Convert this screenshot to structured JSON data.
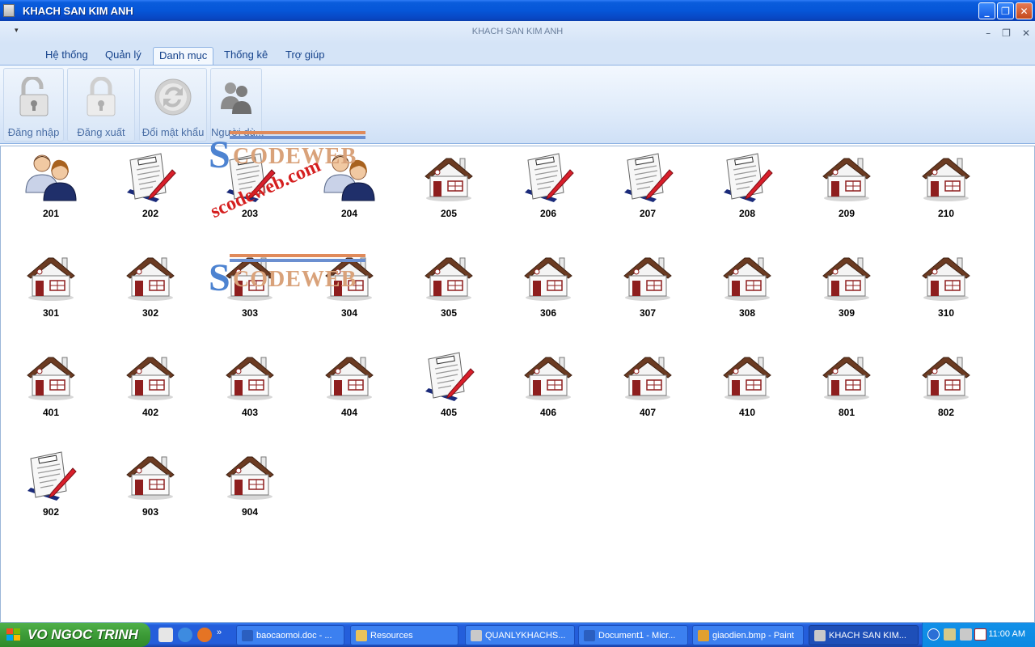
{
  "window": {
    "title": "KHACH SAN KIM ANH",
    "mdi_title": "KHACH SAN KIM ANH"
  },
  "menu_tabs": [
    "Hệ thống",
    "Quản lý",
    "Danh mục",
    "Thống kê",
    "Trợ giúp"
  ],
  "active_tab": "Danh mục",
  "ribbon_buttons": [
    {
      "label": "Đăng nhập",
      "icon": "lock-open-icon"
    },
    {
      "label": "Đăng xuất",
      "icon": "lock-icon"
    },
    {
      "label": "Đổi mật khẩu",
      "icon": "refresh-icon"
    },
    {
      "label": "Người dù...",
      "icon": "users-icon"
    }
  ],
  "rooms": [
    {
      "number": "201",
      "status": "occupied"
    },
    {
      "number": "202",
      "status": "reserved"
    },
    {
      "number": "203",
      "status": "reserved"
    },
    {
      "number": "204",
      "status": "occupied"
    },
    {
      "number": "205",
      "status": "empty"
    },
    {
      "number": "206",
      "status": "reserved"
    },
    {
      "number": "207",
      "status": "reserved"
    },
    {
      "number": "208",
      "status": "reserved"
    },
    {
      "number": "209",
      "status": "empty"
    },
    {
      "number": "210",
      "status": "empty"
    },
    {
      "number": "301",
      "status": "empty"
    },
    {
      "number": "302",
      "status": "empty"
    },
    {
      "number": "303",
      "status": "empty"
    },
    {
      "number": "304",
      "status": "empty"
    },
    {
      "number": "305",
      "status": "empty"
    },
    {
      "number": "306",
      "status": "empty"
    },
    {
      "number": "307",
      "status": "empty"
    },
    {
      "number": "308",
      "status": "empty"
    },
    {
      "number": "309",
      "status": "empty"
    },
    {
      "number": "310",
      "status": "empty"
    },
    {
      "number": "401",
      "status": "empty"
    },
    {
      "number": "402",
      "status": "empty"
    },
    {
      "number": "403",
      "status": "empty"
    },
    {
      "number": "404",
      "status": "empty"
    },
    {
      "number": "405",
      "status": "reserved"
    },
    {
      "number": "406",
      "status": "empty"
    },
    {
      "number": "407",
      "status": "empty"
    },
    {
      "number": "410",
      "status": "empty"
    },
    {
      "number": "801",
      "status": "empty"
    },
    {
      "number": "802",
      "status": "empty"
    },
    {
      "number": "902",
      "status": "reserved"
    },
    {
      "number": "903",
      "status": "empty"
    },
    {
      "number": "904",
      "status": "empty"
    }
  ],
  "watermark": {
    "brand_s": "S",
    "brand_rest": "CODEWEB",
    "url": "scodeweb.com"
  },
  "taskbar": {
    "start_label": "VO NGOC TRINH",
    "buttons": [
      {
        "label": "baocaomoi.doc - ...",
        "icon": "word-icon"
      },
      {
        "label": "Resources",
        "icon": "folder-icon"
      },
      {
        "label": "QUANLYKHACHS...",
        "icon": "app-icon"
      },
      {
        "label": "Document1 - Micr...",
        "icon": "word-icon"
      },
      {
        "label": "giaodien.bmp - Paint",
        "icon": "paint-icon"
      },
      {
        "label": "KHACH SAN KIM...",
        "icon": "app-icon",
        "active": true
      }
    ],
    "clock": "11:00 AM"
  }
}
